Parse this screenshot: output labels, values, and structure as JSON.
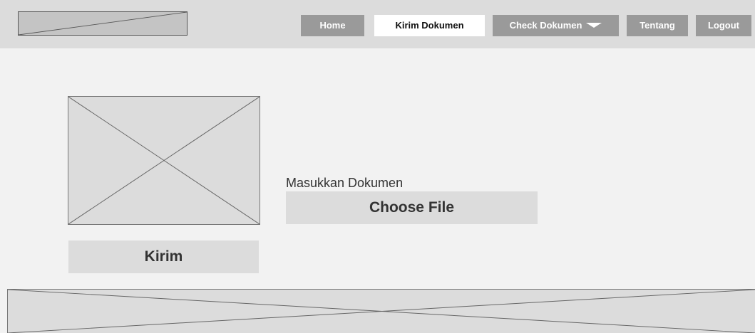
{
  "nav": {
    "items": [
      {
        "label": "Home",
        "active": false
      },
      {
        "label": "Kirim Dokumen",
        "active": true
      },
      {
        "label": "Check Dokumen",
        "active": false,
        "has_dropdown": true
      },
      {
        "label": "Tentang",
        "active": false
      },
      {
        "label": "Logout",
        "active": false
      }
    ]
  },
  "main": {
    "upload_label": "Masukkan Dokumen",
    "choose_file_label": "Choose File",
    "submit_label": "Kirim"
  },
  "colors": {
    "page_bg": "#f2f2f2",
    "navbar_bg": "#dcdcdc",
    "nav_button_bg": "#9a9a9a",
    "nav_active_bg": "#ffffff",
    "placeholder_bg": "#dcdcdc"
  }
}
